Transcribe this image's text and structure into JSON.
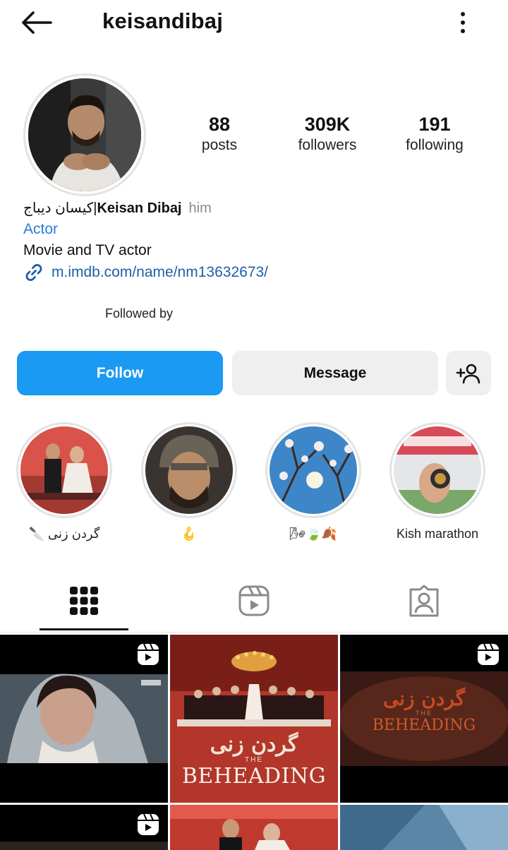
{
  "header": {
    "username": "keisandibaj",
    "back_icon": "arrow-left-icon",
    "more_icon": "more-vertical-icon"
  },
  "stats": {
    "posts": {
      "value": "88",
      "label": "posts"
    },
    "followers": {
      "value": "309K",
      "label": "followers"
    },
    "following": {
      "value": "191",
      "label": "following"
    }
  },
  "profile": {
    "name_persian": "کیسان دیباج|",
    "name_latin": "Keisan Dibaj",
    "pronoun": "him",
    "category": "Actor",
    "bio": "Movie and TV actor",
    "link": "m.imdb.com/name/nm13632673/",
    "followed_by": "Followed by"
  },
  "actions": {
    "follow_label": "Follow",
    "message_label": "Message",
    "add_user_icon": "add-person-icon"
  },
  "highlights": [
    {
      "label": "🔪 گردن زنی"
    },
    {
      "label": "🪝"
    },
    {
      "label": "🌬🍃🍂"
    },
    {
      "label": "Kish marathon"
    }
  ],
  "tabs": [
    {
      "name": "posts-grid",
      "icon": "grid-icon"
    },
    {
      "name": "reels",
      "icon": "reels-icon"
    },
    {
      "name": "tagged",
      "icon": "tagged-person-icon"
    }
  ],
  "grid": {
    "title_text": "گردن زنی",
    "poster_subtitle": "THE",
    "poster_title": "BEHEADING"
  },
  "colors": {
    "accent": "#1a9af2",
    "link": "#1f5fa8",
    "category": "#2a7bd8"
  }
}
